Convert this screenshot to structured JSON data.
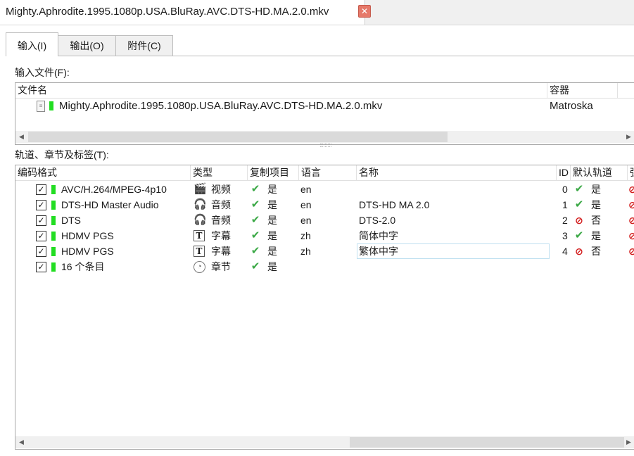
{
  "document": {
    "title": "Mighty.Aphrodite.1995.1080p.USA.BluRay.AVC.DTS-HD.MA.2.0.mkv",
    "close_glyph": "✕"
  },
  "tabs": [
    {
      "label": "输入(I)",
      "active": true
    },
    {
      "label": "输出(O)",
      "active": false
    },
    {
      "label": "附件(C)",
      "active": false
    }
  ],
  "input_files": {
    "label": "输入文件(F):",
    "columns": [
      "文件名",
      "容器"
    ],
    "rows": [
      {
        "name": "Mighty.Aphrodite.1995.1080p.USA.BluRay.AVC.DTS-HD.MA.2.0.mkv",
        "container": "Matroska"
      }
    ]
  },
  "tracks": {
    "label": "轨道、章节及标签(T):",
    "columns": [
      "编码格式",
      "类型",
      "复制项目",
      "语言",
      "名称",
      "ID",
      "默认轨道",
      "强"
    ],
    "rows": [
      {
        "checked": "✓",
        "codec": "AVC/H.264/MPEG-4p10",
        "type_icon": "film-icon",
        "type": "视频",
        "copy": "是",
        "lang": "en",
        "name": "",
        "id": "0",
        "default_icon": "check",
        "default": "是"
      },
      {
        "checked": "✓",
        "codec": "DTS-HD Master Audio",
        "type_icon": "headphones-icon",
        "type": "音频",
        "copy": "是",
        "lang": "en",
        "name": "DTS-HD MA 2.0",
        "id": "1",
        "default_icon": "check",
        "default": "是"
      },
      {
        "checked": "✓",
        "codec": "DTS",
        "type_icon": "headphones-icon",
        "type": "音频",
        "copy": "是",
        "lang": "en",
        "name": "DTS-2.0",
        "id": "2",
        "default_icon": "no",
        "default": "否"
      },
      {
        "checked": "✓",
        "codec": "HDMV PGS",
        "type_icon": "text-icon",
        "type": "字幕",
        "copy": "是",
        "lang": "zh",
        "name": "简体中字",
        "id": "3",
        "default_icon": "check",
        "default": "是"
      },
      {
        "checked": "✓",
        "codec": "HDMV PGS",
        "type_icon": "text-icon",
        "type": "字幕",
        "copy": "是",
        "lang": "zh",
        "name": "繁体中字",
        "id": "4",
        "default_icon": "no",
        "default": "否"
      },
      {
        "checked": "✓",
        "codec": "16 个条目",
        "type_icon": "clock-icon",
        "type": "章节",
        "copy": "是",
        "lang": "",
        "name": "",
        "id": "",
        "default_icon": "",
        "default": ""
      }
    ]
  },
  "colors": {
    "accent_green": "#22dd22",
    "ok": "#3aa845",
    "no": "#d21a1a",
    "close": "#e6796a"
  }
}
